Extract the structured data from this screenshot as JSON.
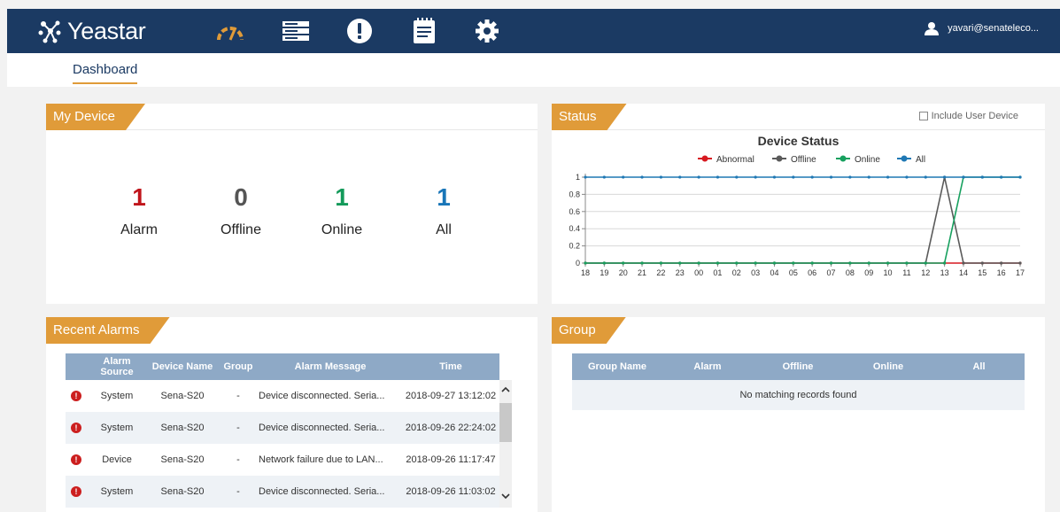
{
  "brand": {
    "name": "Yeastar"
  },
  "nav": {
    "icons": [
      "dashboard-gauge-icon",
      "devices-server-icon",
      "alert-icon",
      "logs-notepad-icon",
      "settings-gear-icon"
    ],
    "active_color": "#e09b39"
  },
  "user": {
    "name": "yavari@senateleco..."
  },
  "tabs": {
    "dashboard": "Dashboard"
  },
  "my_device": {
    "title": "My Device",
    "stats": [
      {
        "value": "1",
        "label": "Alarm",
        "color": "#c0151b"
      },
      {
        "value": "0",
        "label": "Offline",
        "color": "#555555"
      },
      {
        "value": "1",
        "label": "Online",
        "color": "#139a5a"
      },
      {
        "value": "1",
        "label": "All",
        "color": "#1976b8"
      }
    ]
  },
  "status": {
    "title": "Status",
    "include_user_device": "Include User Device",
    "include_checked": false
  },
  "chart_data": {
    "type": "line",
    "title": "Device Status",
    "x": [
      "18",
      "19",
      "20",
      "21",
      "22",
      "23",
      "00",
      "01",
      "02",
      "03",
      "04",
      "05",
      "06",
      "07",
      "08",
      "09",
      "10",
      "11",
      "12",
      "13",
      "14",
      "15",
      "16",
      "17"
    ],
    "ylim": [
      0,
      1
    ],
    "yticks": [
      "0",
      "0.2",
      "0.4",
      "0.6",
      "0.8",
      "1"
    ],
    "legend_position": "top-center",
    "grid": true,
    "series": [
      {
        "name": "Abnormal",
        "color": "#d71920",
        "values": [
          0,
          0,
          0,
          0,
          0,
          0,
          0,
          0,
          0,
          0,
          0,
          0,
          0,
          0,
          0,
          0,
          0,
          0,
          0,
          0,
          0,
          0,
          0,
          0
        ]
      },
      {
        "name": "Offline",
        "color": "#5a5a5a",
        "values": [
          0,
          0,
          0,
          0,
          0,
          0,
          0,
          0,
          0,
          0,
          0,
          0,
          0,
          0,
          0,
          0,
          0,
          0,
          0,
          1,
          0,
          0,
          0,
          0
        ]
      },
      {
        "name": "Online",
        "color": "#16a05e",
        "values": [
          0,
          0,
          0,
          0,
          0,
          0,
          0,
          0,
          0,
          0,
          0,
          0,
          0,
          0,
          0,
          0,
          0,
          0,
          0,
          0,
          1,
          1,
          1,
          1
        ]
      },
      {
        "name": "All",
        "color": "#1f78b4",
        "values": [
          1,
          1,
          1,
          1,
          1,
          1,
          1,
          1,
          1,
          1,
          1,
          1,
          1,
          1,
          1,
          1,
          1,
          1,
          1,
          1,
          1,
          1,
          1,
          1
        ]
      }
    ]
  },
  "recent_alarms": {
    "title": "Recent Alarms",
    "columns": [
      "Alarm Source",
      "Device Name",
      "Group",
      "Alarm Message",
      "Time"
    ],
    "rows": [
      {
        "source": "System",
        "device": "Sena-S20",
        "group": "-",
        "message": "Device disconnected. Seria...",
        "time": "2018-09-27 13:12:02"
      },
      {
        "source": "System",
        "device": "Sena-S20",
        "group": "-",
        "message": "Device disconnected. Seria...",
        "time": "2018-09-26 22:24:02"
      },
      {
        "source": "Device",
        "device": "Sena-S20",
        "group": "-",
        "message": "Network failure due to LAN...",
        "time": "2018-09-26 11:17:47"
      },
      {
        "source": "System",
        "device": "Sena-S20",
        "group": "-",
        "message": "Device disconnected. Seria...",
        "time": "2018-09-26 11:03:02"
      }
    ]
  },
  "group": {
    "title": "Group",
    "columns": [
      "Group Name",
      "Alarm",
      "Offline",
      "Online",
      "All"
    ],
    "empty_message": "No matching records found"
  }
}
